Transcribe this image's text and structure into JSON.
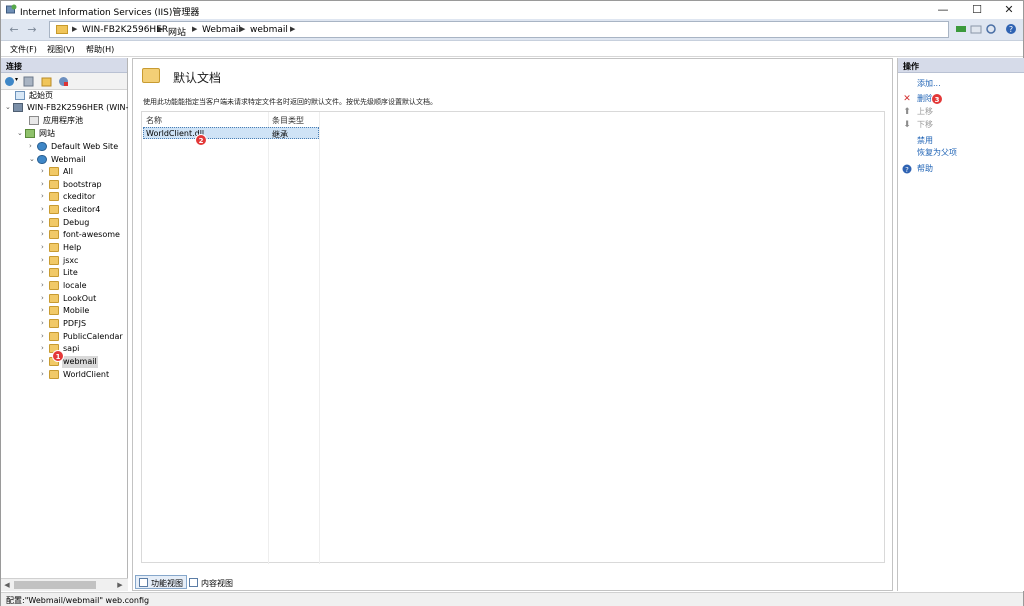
{
  "window": {
    "title": "Internet Information Services (IIS)管理器",
    "controls": {
      "minimize": "—",
      "maximize": "☐",
      "close": "✕"
    }
  },
  "address_bar": {
    "back_icon": "back-arrow-icon",
    "forward_icon": "forward-arrow-icon",
    "breadcrumbs": [
      "WIN-FB2K2596HER",
      "网站",
      "Webmail",
      "webmail"
    ]
  },
  "menu": {
    "items": [
      "文件(F)",
      "视图(V)",
      "帮助(H)"
    ]
  },
  "connections": {
    "header": "连接",
    "tree": [
      {
        "label": "起始页",
        "icon": "start-page-icon"
      },
      {
        "label": "WIN-FB2K2596HER (WIN-F",
        "icon": "server-icon"
      },
      {
        "label": "应用程序池",
        "icon": "app-pool-icon"
      },
      {
        "label": "网站",
        "icon": "sites-icon"
      },
      {
        "label": "Default Web Site",
        "icon": "globe-icon"
      },
      {
        "label": "Webmail",
        "icon": "globe-icon"
      },
      {
        "label": "All",
        "icon": "folder-icon"
      },
      {
        "label": "bootstrap",
        "icon": "folder-icon"
      },
      {
        "label": "ckeditor",
        "icon": "folder-icon"
      },
      {
        "label": "ckeditor4",
        "icon": "folder-icon"
      },
      {
        "label": "Debug",
        "icon": "folder-icon"
      },
      {
        "label": "font-awesome",
        "icon": "folder-icon"
      },
      {
        "label": "Help",
        "icon": "folder-icon"
      },
      {
        "label": "jsxc",
        "icon": "folder-icon"
      },
      {
        "label": "Lite",
        "icon": "folder-icon"
      },
      {
        "label": "locale",
        "icon": "folder-icon"
      },
      {
        "label": "LookOut",
        "icon": "folder-icon"
      },
      {
        "label": "Mobile",
        "icon": "folder-icon"
      },
      {
        "label": "PDFJS",
        "icon": "folder-icon"
      },
      {
        "label": "PublicCalendar",
        "icon": "folder-icon"
      },
      {
        "label": "sapi",
        "icon": "folder-icon"
      },
      {
        "label": "webmail",
        "icon": "folder-icon",
        "selected": true
      },
      {
        "label": "WorldClient",
        "icon": "folder-icon"
      }
    ]
  },
  "feature": {
    "title": "默认文档",
    "description": "使用此功能能指定当客户端未请求特定文件名时返回的默认文件。按优先级顺序设置默认文档。",
    "columns": [
      "名称",
      "条目类型"
    ],
    "rows": [
      {
        "name": "WorldClient.dll",
        "type": "继承"
      }
    ],
    "view_tabs": [
      "功能视图",
      "内容视图"
    ]
  },
  "actions": {
    "header": "操作",
    "items": [
      {
        "label": "添加...",
        "icon": "",
        "state": "link"
      },
      {
        "label": "删除",
        "icon": "delete-x-icon",
        "state": "link"
      },
      {
        "label": "上移",
        "icon": "up-arrow-icon",
        "state": "disabled"
      },
      {
        "label": "下移",
        "icon": "down-arrow-icon",
        "state": "disabled"
      },
      {
        "label": "禁用",
        "icon": "",
        "state": "link"
      },
      {
        "label": "恢复为父项",
        "icon": "",
        "state": "link"
      },
      {
        "label": "帮助",
        "icon": "help-icon",
        "state": "link"
      }
    ]
  },
  "markers": [
    "1",
    "2",
    "3"
  ],
  "status": {
    "text": "配置:\"Webmail/webmail\" web.config"
  },
  "colors": {
    "accent_link": "#1f63b5",
    "selection": "#cfe3f6",
    "marker": "#e33838",
    "delete_icon": "#d22b2b"
  }
}
